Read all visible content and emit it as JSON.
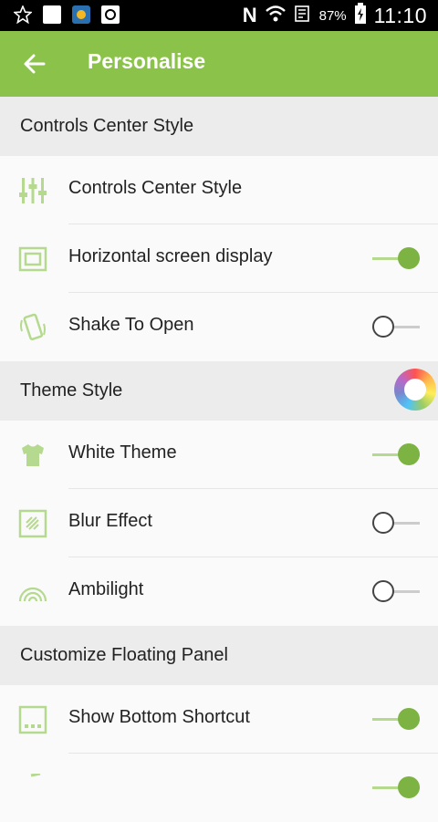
{
  "status": {
    "battery": "87%",
    "time": "11:10"
  },
  "appbar": {
    "title": "Personalise"
  },
  "sections": [
    {
      "title": "Controls Center Style",
      "items": [
        {
          "label": "Controls Center Style",
          "toggle": null
        },
        {
          "label": "Horizontal screen display",
          "toggle": "on"
        },
        {
          "label": "Shake To Open",
          "toggle": "off"
        }
      ]
    },
    {
      "title": "Theme Style",
      "items": [
        {
          "label": "White Theme",
          "toggle": "on"
        },
        {
          "label": "Blur Effect",
          "toggle": "off"
        },
        {
          "label": "Ambilight",
          "toggle": "off"
        }
      ]
    },
    {
      "title": "Customize Floating Panel",
      "items": [
        {
          "label": "Show Bottom Shortcut",
          "toggle": "on"
        }
      ]
    }
  ],
  "colors": {
    "accent": "#8bc34a",
    "icon": "#b5d98f"
  }
}
